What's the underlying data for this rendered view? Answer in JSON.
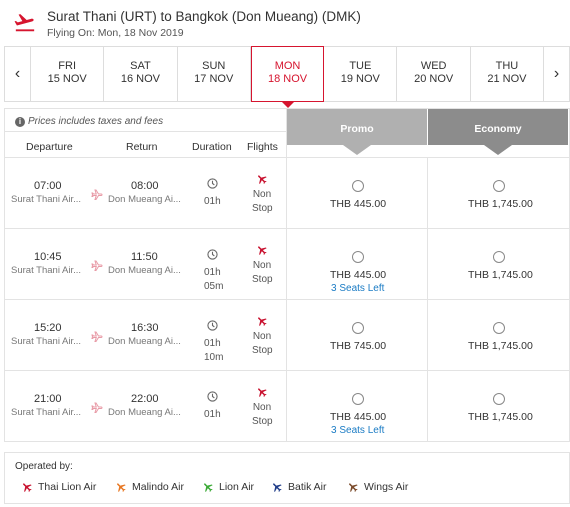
{
  "header": {
    "title": "Surat Thani (URT) to Bangkok (Don Mueang) (DMK)",
    "subtitle": "Flying On: Mon, 18 Nov 2019",
    "accent": "#d6152f"
  },
  "dates": [
    {
      "dow": "FRI",
      "date": "15 NOV",
      "selected": false
    },
    {
      "dow": "SAT",
      "date": "16 NOV",
      "selected": false
    },
    {
      "dow": "SUN",
      "date": "17 NOV",
      "selected": false
    },
    {
      "dow": "MON",
      "date": "18 NOV",
      "selected": true
    },
    {
      "dow": "TUE",
      "date": "19 NOV",
      "selected": false
    },
    {
      "dow": "WED",
      "date": "20 NOV",
      "selected": false
    },
    {
      "dow": "THU",
      "date": "21 NOV",
      "selected": false
    }
  ],
  "nav": {
    "prev": "‹",
    "next": "›"
  },
  "table": {
    "note": "Prices includes taxes and fees",
    "columns": {
      "departure": "Departure",
      "return": "Return",
      "duration": "Duration",
      "flights": "Flights"
    },
    "fares": {
      "promo": "Promo",
      "economy": "Economy"
    }
  },
  "flights": [
    {
      "dep_time": "07:00",
      "dep_airport": "Surat Thani Air...",
      "arr_time": "08:00",
      "arr_airport": "Don Mueang Ai...",
      "duration": [
        "01h"
      ],
      "stops": [
        "Non",
        "Stop"
      ],
      "promo_price": "THB 445.00",
      "promo_note": "",
      "economy_price": "THB 1,745.00"
    },
    {
      "dep_time": "10:45",
      "dep_airport": "Surat Thani Air...",
      "arr_time": "11:50",
      "arr_airport": "Don Mueang Ai...",
      "duration": [
        "01h",
        "05m"
      ],
      "stops": [
        "Non",
        "Stop"
      ],
      "promo_price": "THB 445.00",
      "promo_note": "3 Seats Left",
      "economy_price": "THB 1,745.00"
    },
    {
      "dep_time": "15:20",
      "dep_airport": "Surat Thani Air...",
      "arr_time": "16:30",
      "arr_airport": "Don Mueang Ai...",
      "duration": [
        "01h",
        "10m"
      ],
      "stops": [
        "Non",
        "Stop"
      ],
      "promo_price": "THB 745.00",
      "promo_note": "",
      "economy_price": "THB 1,745.00"
    },
    {
      "dep_time": "21:00",
      "dep_airport": "Surat Thani Air...",
      "arr_time": "22:00",
      "arr_airport": "Don Mueang Ai...",
      "duration": [
        "01h"
      ],
      "stops": [
        "Non",
        "Stop"
      ],
      "promo_price": "THB 445.00",
      "promo_note": "3 Seats Left",
      "economy_price": "THB 1,745.00"
    }
  ],
  "operated_by": {
    "label": "Operated by:",
    "airlines": [
      {
        "name": "Thai Lion Air",
        "color": "#c8102e",
        "icon": "plane-icon"
      },
      {
        "name": "Malindo Air",
        "color": "#e87722",
        "icon": "plane-icon"
      },
      {
        "name": "Lion Air",
        "color": "#3aa935",
        "icon": "plane-icon"
      },
      {
        "name": "Batik Air",
        "color": "#1f3c88",
        "icon": "plane-icon"
      },
      {
        "name": "Wings Air",
        "color": "#7a4a2a",
        "icon": "plane-icon"
      }
    ]
  }
}
